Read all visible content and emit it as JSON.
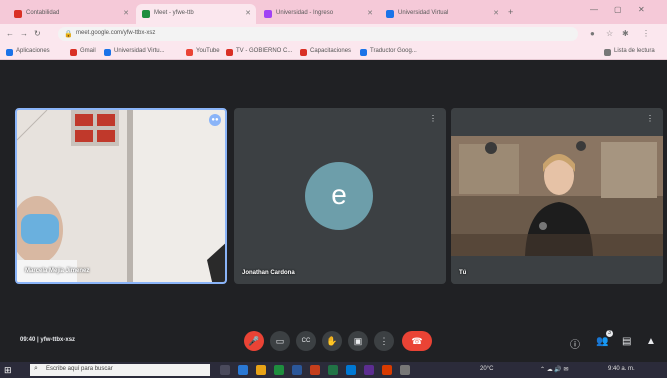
{
  "browser": {
    "tabs": [
      {
        "label": "Contabilidad",
        "color": "#d93025"
      },
      {
        "label": "Meet - yfwe-ttb",
        "color": "#1e8e3e"
      },
      {
        "label": "Universidad - Ingreso",
        "color": "#a142f4"
      },
      {
        "label": "Universidad Virtual",
        "color": "#1a73e8"
      }
    ],
    "new_tab": "+",
    "address": "meet.google.com/yfw-ttbx-xsz",
    "bookmarks": [
      {
        "label": "Aplicaciones",
        "color": "#1a73e8"
      },
      {
        "label": "Gmail",
        "color": "#d93025"
      },
      {
        "label": "Universidad Virtu...",
        "color": "#1a73e8"
      },
      {
        "label": "YouTube",
        "color": "#ea4335"
      },
      {
        "label": "TV - GOBIERNO C...",
        "color": "#d93025"
      },
      {
        "label": "Capacitaciones",
        "color": "#d93025"
      },
      {
        "label": "Traductor Goog...",
        "color": "#1a73e8"
      }
    ],
    "reading_list": "Lista de lectura"
  },
  "meeting": {
    "participants": [
      {
        "name": "Marcela Mejia Jimenez"
      },
      {
        "name": "Jonathan Cardona",
        "initial": "e"
      },
      {
        "name": "Tú"
      }
    ],
    "time_label": "09:40  |  yfw-ttbx-xsz",
    "controls": {
      "mic": "🎤",
      "camera": "▭",
      "captions": "CC",
      "raise_hand": "✋",
      "present": "▣",
      "more": "⋮",
      "end_call": "☎"
    },
    "participant_count": "3"
  },
  "taskbar": {
    "search_placeholder": "Escribe aquí para buscar",
    "tray_weather": "20°C",
    "tray_time": "9:40 a. m."
  }
}
